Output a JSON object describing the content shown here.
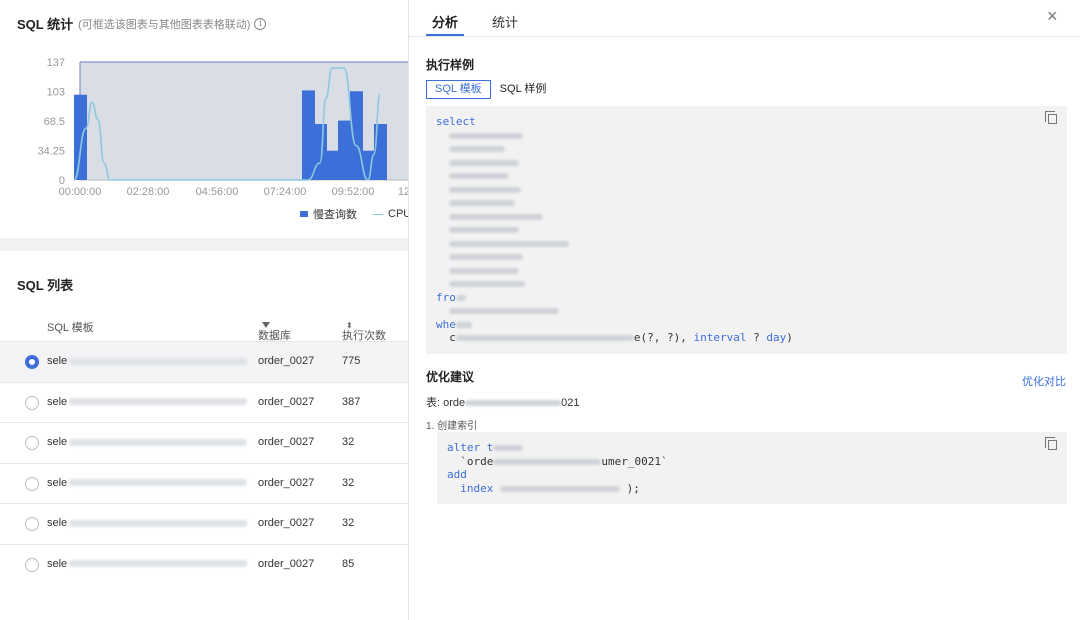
{
  "stats": {
    "title": "SQL 统计",
    "hint": "(可框选该图表与其他图表表格联动)",
    "info_icon": "info-icon"
  },
  "chart_data": {
    "type": "bar",
    "ylim": [
      0,
      137
    ],
    "y_ticks": [
      "137",
      "103",
      "68.5",
      "34.25",
      "0"
    ],
    "x_ticks": [
      "00:00:00",
      "02:28:00",
      "04:56:00",
      "07:24:00",
      "09:52:00",
      "12"
    ],
    "series": [
      {
        "name": "慢查询数",
        "kind": "bar",
        "color": "#3d6fd9",
        "x": [
          0,
          19,
          20,
          21,
          22,
          23,
          24,
          25
        ],
        "values": [
          99,
          104,
          65,
          34,
          69,
          103,
          34,
          65
        ]
      },
      {
        "name": "CPU",
        "kind": "line",
        "color": "#8cc9dd",
        "x": [
          0,
          0.5,
          1,
          1.5,
          2,
          2.5,
          3,
          18,
          19,
          20,
          20.5,
          21,
          22,
          23,
          24,
          24.5,
          25
        ],
        "values": [
          0,
          60,
          90,
          70,
          20,
          0,
          0,
          0,
          0,
          20,
          95,
          130,
          130,
          40,
          0,
          30,
          100
        ]
      }
    ],
    "legend_position": "bottom-right",
    "grid": false
  },
  "list": {
    "title": "SQL 列表",
    "columns": {
      "template": "SQL 模板",
      "database": "数据库",
      "count": "执行次数"
    },
    "rows": [
      {
        "prefix": "sele",
        "database": "order_0027",
        "count": "775",
        "selected": true
      },
      {
        "prefix": "sele",
        "database": "order_0027",
        "count": "387",
        "selected": false
      },
      {
        "prefix": "sele",
        "database": "order_0027",
        "count": "32",
        "selected": false
      },
      {
        "prefix": "sele",
        "database": "order_0027",
        "count": "32",
        "selected": false
      },
      {
        "prefix": "sele",
        "database": "order_0027",
        "count": "32",
        "selected": false
      },
      {
        "prefix": "sele",
        "database": "order_0027",
        "count": "85",
        "selected": false
      }
    ]
  },
  "panel": {
    "tabs": [
      "分析",
      "统计"
    ],
    "close": "×",
    "exec_title": "执行样例",
    "sub_tabs": [
      "SQL 模板",
      "SQL 样例"
    ],
    "code": {
      "select": "select",
      "from": "fro",
      "where": "whe",
      "where_tail": "e(?, ?), ",
      "interval": "interval",
      "interval_tail": " ? ",
      "day": "day",
      "close_paren": ")",
      "where_lead": "c"
    },
    "opt_title": "优化建议",
    "opt_link": "优化对比",
    "opt_table_prefix": "表: orde",
    "opt_table_suffix": "021",
    "opt_item": "1. 创建索引",
    "index_code": {
      "alter": "alter t",
      "order_prefix": "`orde",
      "order_suffix": "umer_0021`",
      "add": "add",
      "index": "index",
      "index_tail": ");"
    }
  }
}
